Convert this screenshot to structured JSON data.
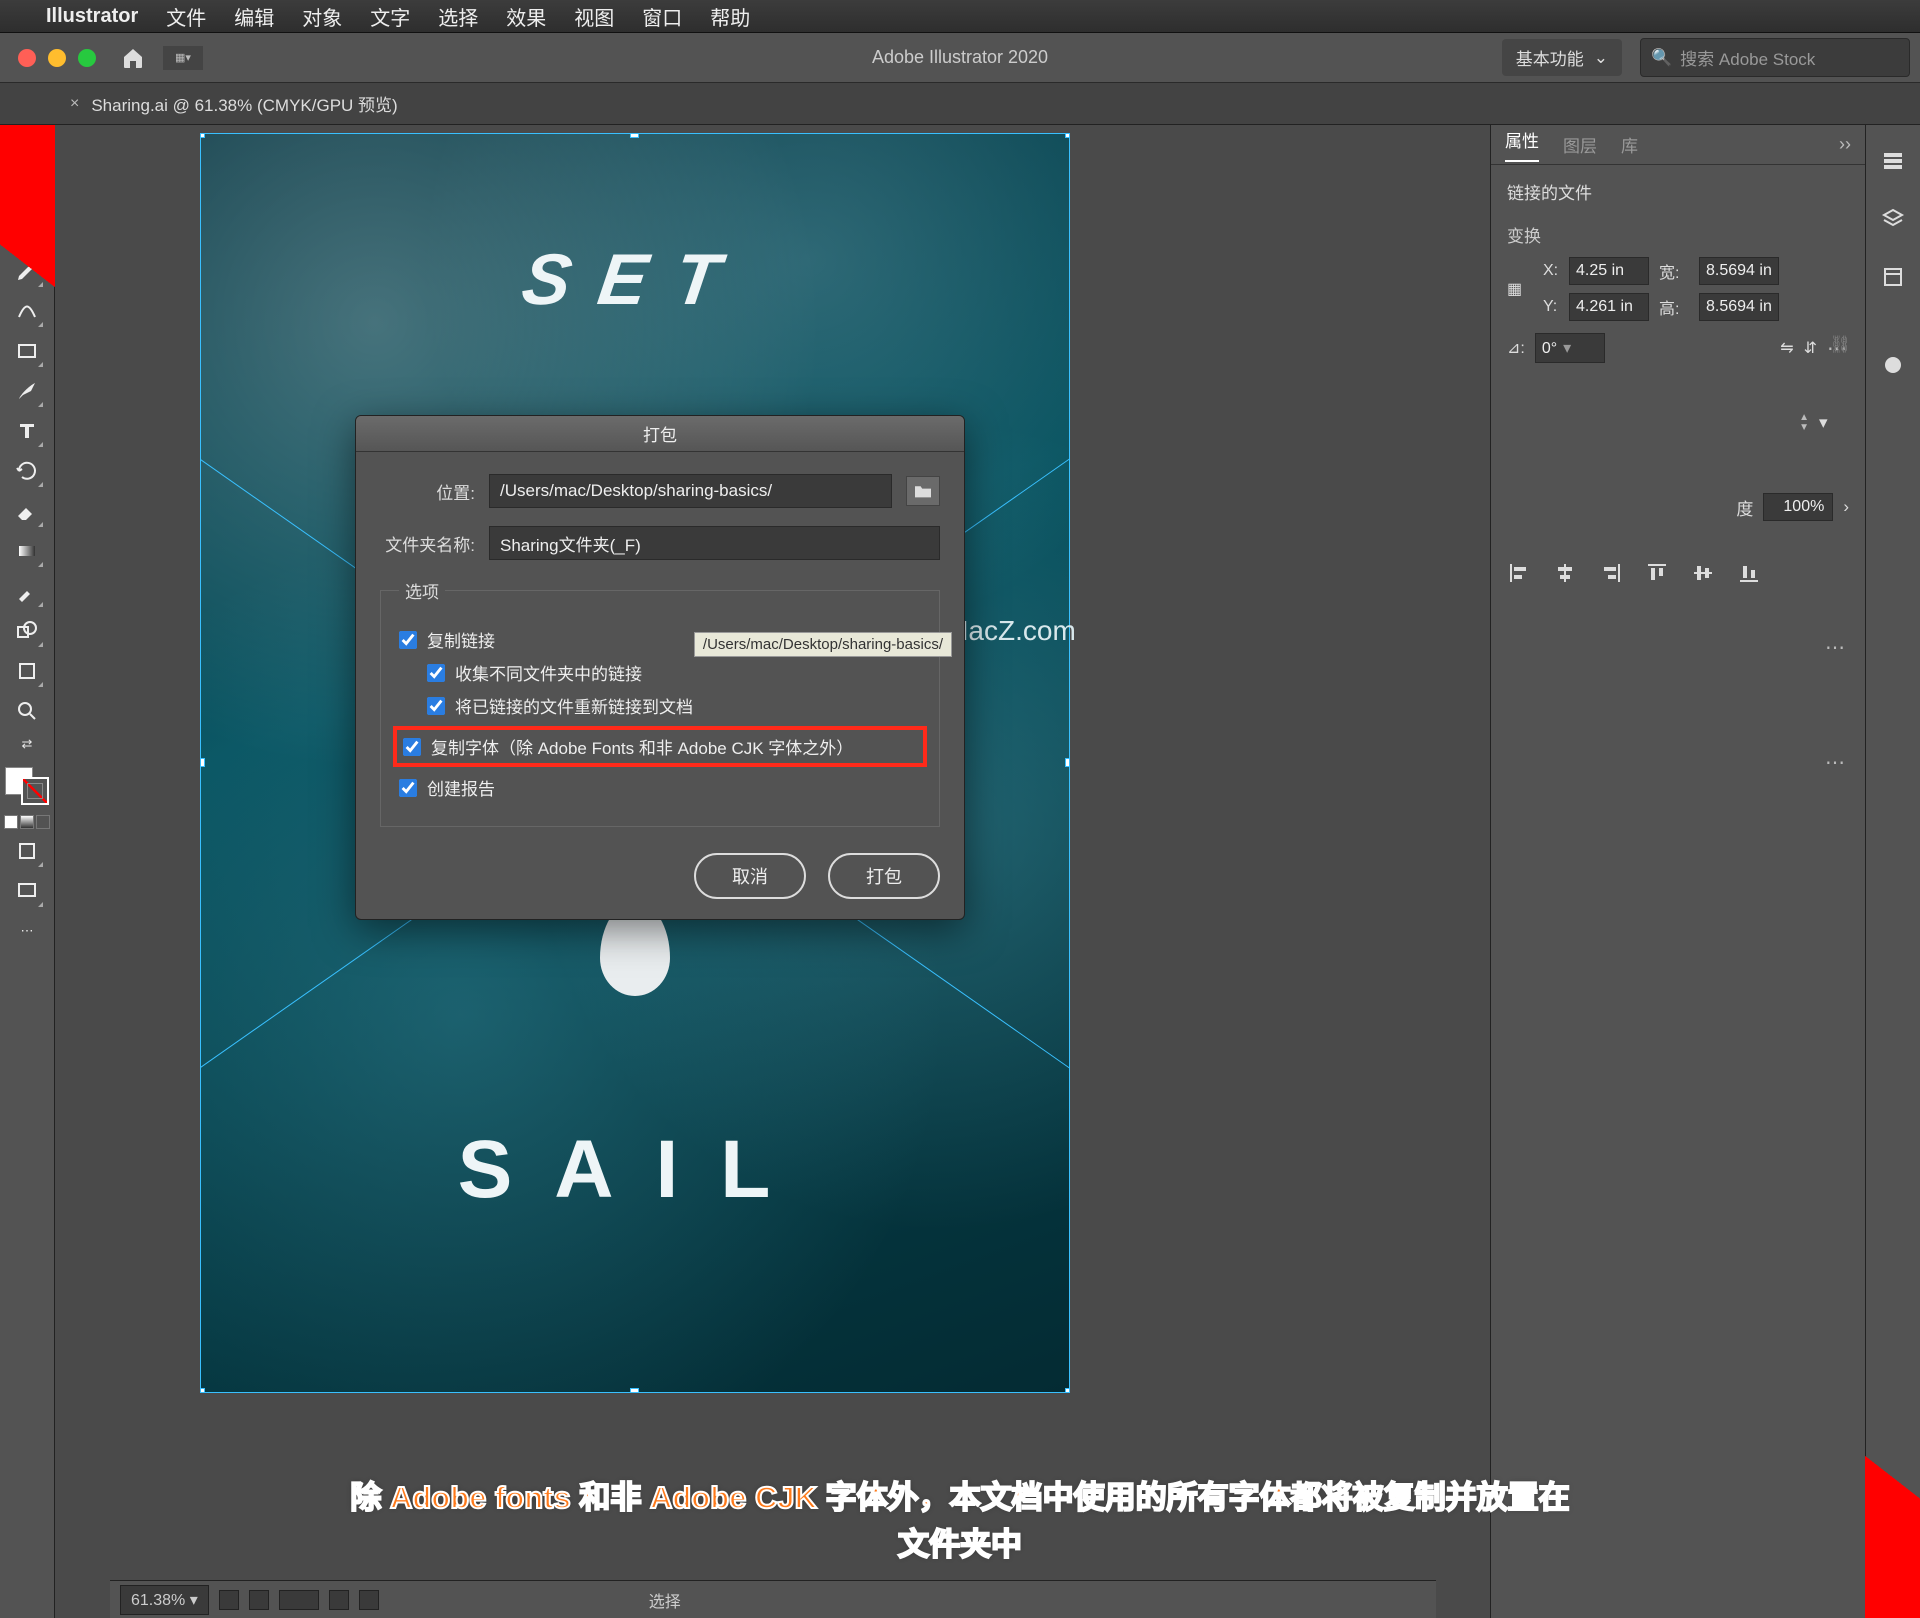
{
  "menubar": {
    "app": "Illustrator",
    "items": [
      "文件",
      "编辑",
      "对象",
      "文字",
      "选择",
      "效果",
      "视图",
      "窗口",
      "帮助"
    ]
  },
  "appbar": {
    "title": "Adobe Illustrator 2020",
    "workspace": "基本功能",
    "search_placeholder": "搜索 Adobe Stock"
  },
  "tab": {
    "label": "Sharing.ai @ 61.38% (CMYK/GPU 预览)"
  },
  "artboard": {
    "text_top": "SET",
    "text_bottom": "SAIL"
  },
  "watermark": "www.MacZ.com",
  "properties": {
    "tabs": [
      "属性",
      "图层",
      "库"
    ],
    "active_tab": "属性",
    "section_title": "链接的文件",
    "transform_label": "变换",
    "x_label": "X:",
    "y_label": "Y:",
    "w_label": "宽:",
    "h_label": "高:",
    "x": "4.25 in",
    "y": "4.261 in",
    "w": "8.5694 in",
    "h": "8.5694 in",
    "angle_label": "⊿:",
    "angle": "0°",
    "opacity_label": "度",
    "opacity": "100%"
  },
  "dialog": {
    "title": "打包",
    "location_label": "位置:",
    "location": "/Users/mac/Desktop/sharing-basics/",
    "folder_label": "文件夹名称:",
    "folder_value": "Sharing文件夹(_F)",
    "tooltip": "/Users/mac/Desktop/sharing-basics/",
    "options_label": "选项",
    "opts": {
      "copy_links": "复制链接",
      "collect": "收集不同文件夹中的链接",
      "relink": "将已链接的文件重新链接到文档",
      "copy_fonts": "复制字体（除 Adobe Fonts 和非 Adobe CJK 字体之外）",
      "report": "创建报告"
    },
    "cancel": "取消",
    "ok": "打包"
  },
  "status": {
    "zoom": "61.38%",
    "selection": "选择"
  },
  "caption_line1": "除 Adobe fonts 和非 Adobe CJK 字体外，本文档中使用的所有字体都将被复制并放置在",
  "caption_line2": "文件夹中"
}
